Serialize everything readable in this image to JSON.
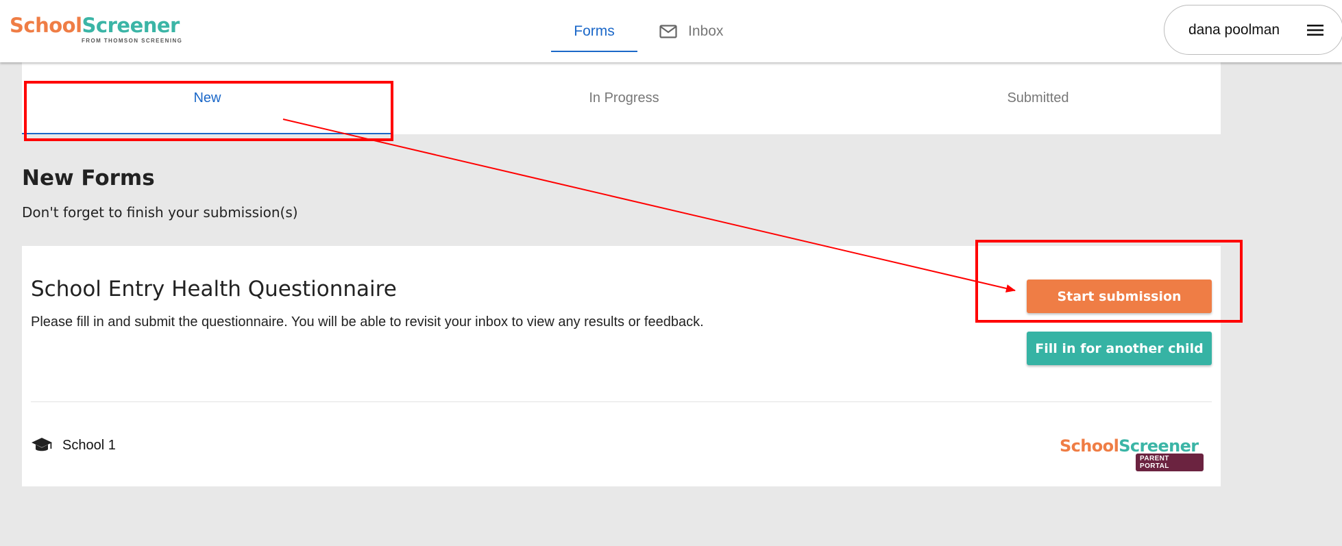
{
  "header": {
    "logo": {
      "part1": "School",
      "part2": "Screener",
      "tagline": "FROM THOMSON SCREENING"
    },
    "nav": {
      "forms_label": "Forms",
      "inbox_label": "Inbox"
    },
    "user": {
      "name": "dana poolman"
    }
  },
  "tabs": [
    {
      "label": "New"
    },
    {
      "label": "In Progress"
    },
    {
      "label": "Submitted"
    }
  ],
  "section": {
    "title": "New Forms",
    "subtitle": "Don't forget to finish your submission(s)"
  },
  "card": {
    "title": "School Entry Health Questionnaire",
    "description": "Please fill in and submit the questionnaire. You will be able to revisit your inbox to view any results or feedback.",
    "start_label": "Start submission",
    "other_child_label": "Fill in for another child",
    "school_name": "School 1",
    "footer_logo": {
      "part1": "School",
      "part2": "Screener",
      "badge": "PARENT PORTAL"
    }
  },
  "colors": {
    "accent_blue": "#1a67c8",
    "brand_orange": "#ef7d45",
    "brand_teal": "#36b3a4",
    "annotation_red": "#ff0000"
  },
  "icons": [
    "mail-icon",
    "hamburger-menu-icon",
    "graduation-cap-icon"
  ]
}
